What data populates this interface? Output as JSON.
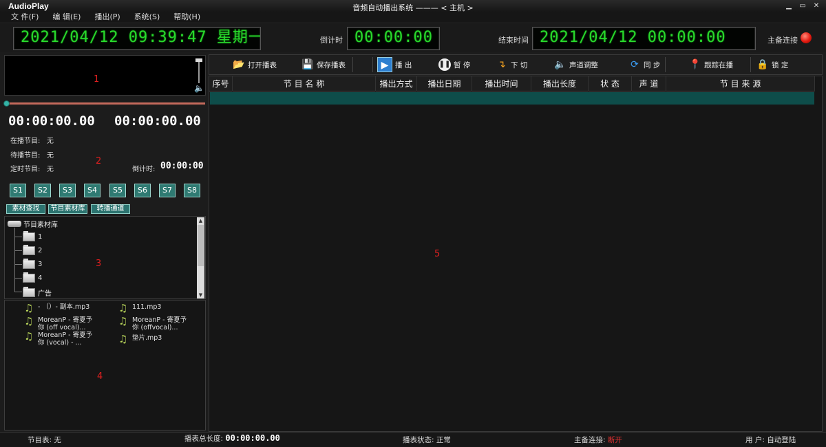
{
  "window": {
    "app_name": "AudioPlay",
    "title": "音频自动播出系统 ——— < 主机 >",
    "min": "▁",
    "max": "▭",
    "close": "✕"
  },
  "menu": [
    "文 件(F)",
    "编 辑(E)",
    "播出(P)",
    "系统(S)",
    "帮助(H)"
  ],
  "clock": {
    "datetime": "2021/04/12  09:39:47  星期一",
    "countdown_label": "倒计时",
    "countdown": "00:00:00",
    "end_label": "结束时间",
    "end_time": "2021/04/12  00:00:00",
    "backup_label": "主备连接",
    "led_color": "#e31a10"
  },
  "player": {
    "elapsed": "00:00:00.00",
    "remaining": "00:00:00.00",
    "playing_label": "在播节目:",
    "playing_value": "无",
    "next_label": "待播节目:",
    "next_value": "无",
    "timed_label": "定时节目:",
    "timed_value": "无",
    "countdown_label": "倒计时:",
    "countdown_value": "00:00:00",
    "progress": 0
  },
  "slots": [
    "S1",
    "S2",
    "S3",
    "S4",
    "S5",
    "S6",
    "S7",
    "S8"
  ],
  "left_tabs": [
    "素材查找",
    "节目素材库",
    "转播通道"
  ],
  "tree": {
    "root": "节目素材库",
    "items": [
      "1",
      "2",
      "3",
      "4",
      "广告"
    ]
  },
  "files": [
    {
      "line1": "- （）- 副本.mp3",
      "line2": ""
    },
    {
      "line1": "111.mp3",
      "line2": ""
    },
    {
      "line1": "MoreanP - 寄夏予",
      "line2": "你 (off vocal)..."
    },
    {
      "line1": "MoreanP - 寄夏予",
      "line2": "你 (offvocal)..."
    },
    {
      "line1": "MoreanP - 寄夏予",
      "line2": "你 (vocal) - ..."
    },
    {
      "line1": "垫片.mp3",
      "line2": ""
    }
  ],
  "toolbar": {
    "open": "打开播表",
    "save": "保存播表",
    "play": "播 出",
    "pause": "暂 停",
    "next": "下 切",
    "channel": "声道调整",
    "sync": "同 步",
    "track": "跟踪在播",
    "lock": "锁 定"
  },
  "columns": [
    "序号",
    "节 目 名 称",
    "播出方式",
    "播出日期",
    "播出时间",
    "播出长度",
    "状 态",
    "声 道",
    "节 目 来 源"
  ],
  "zones": [
    "1",
    "2",
    "3",
    "4",
    "5"
  ],
  "status": {
    "schedule_label": "节目表:",
    "schedule_value": "无",
    "total_label": "播表总长度:",
    "total_value": "00:00:00.00",
    "state_label": "播表状态:",
    "state_value": "正常",
    "backup_label": "主备连接:",
    "backup_value": "断开",
    "user_label": "用 户:",
    "user_value": "自动登陆"
  }
}
